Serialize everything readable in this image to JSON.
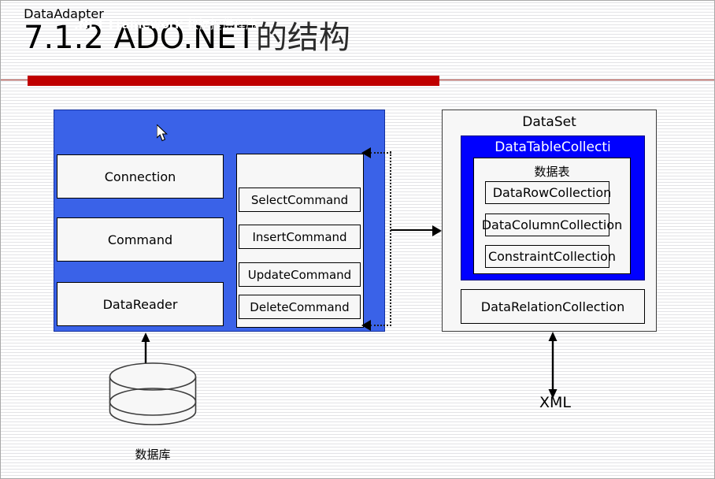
{
  "slide": {
    "title_number": "7.1.2  ADO.NET",
    "title_cn": "的结构",
    "accent_red": "#c00000",
    "panel_blue": "#3a62e8",
    "collection_blue": "#0000ff"
  },
  "provider": {
    "header_en": ".NET Framework",
    "header_cn": " 数据提供程序",
    "boxes": [
      {
        "label": "Connection"
      },
      {
        "label": "Command"
      },
      {
        "label": "DataReader"
      }
    ],
    "adapter": {
      "title": "DataAdapter",
      "commands": [
        {
          "label": "SelectCommand"
        },
        {
          "label": "InsertCommand"
        },
        {
          "label": "UpdateCommand"
        },
        {
          "label": "DeleteCommand"
        }
      ]
    }
  },
  "dataset": {
    "title": "DataSet",
    "table_collection_title": "DataTableCollecti",
    "table_title": "数据表",
    "collections": [
      {
        "label": "DataRowCollection"
      },
      {
        "label": "DataColumnCollection"
      },
      {
        "label": "ConstraintCollection"
      }
    ],
    "relation_collection": "DataRelationCollection"
  },
  "bottom": {
    "database_label": "数据库",
    "xml_label": "XML"
  }
}
